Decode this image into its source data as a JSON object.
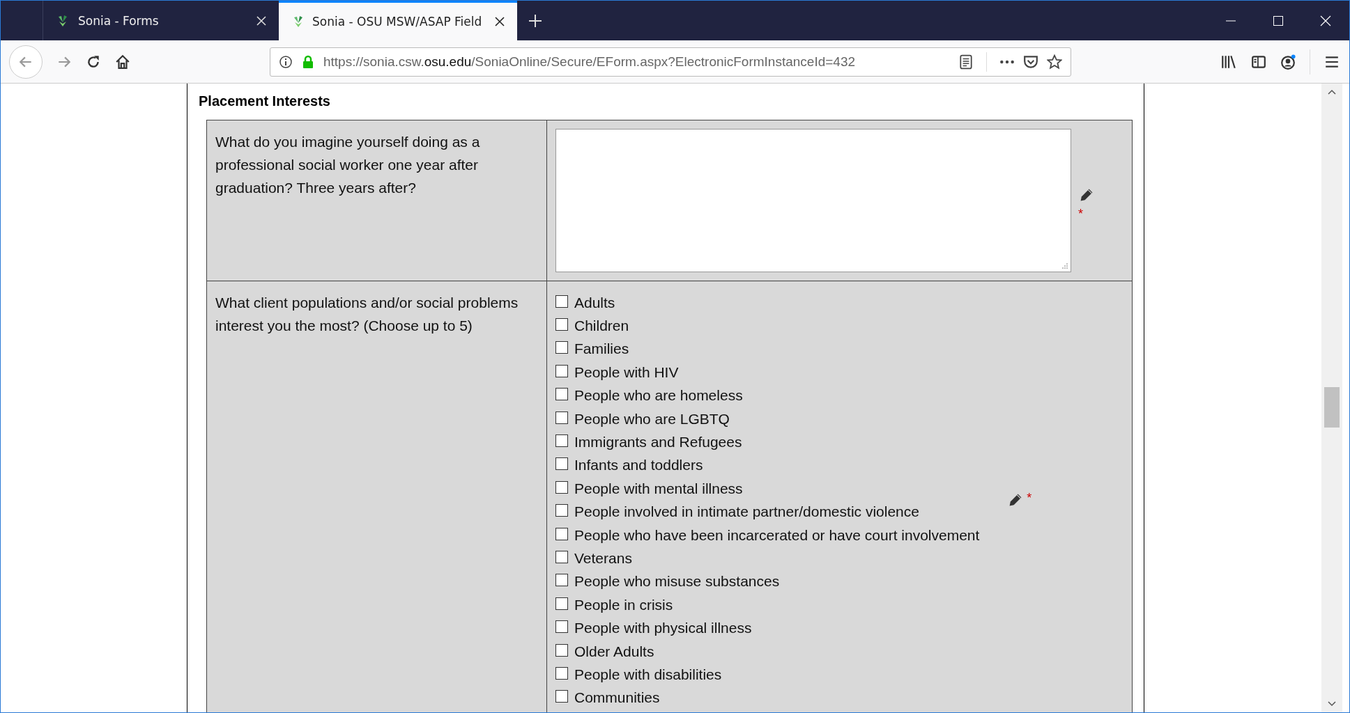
{
  "tabs": [
    {
      "title": "Sonia - Forms",
      "selected": false
    },
    {
      "title": "Sonia - OSU MSW/ASAP Field",
      "selected": true
    }
  ],
  "required_mark": "*",
  "address_bar": {
    "url_start": "https://sonia.csw.",
    "url_domain": "osu.edu",
    "url_end": "/SoniaOnline/Secure/EForm.aspx?ElectronicFormInstanceId=432"
  },
  "section": {
    "title": "Placement Interests"
  },
  "questions": [
    {
      "kind": "textarea",
      "label": "What do you imagine yourself doing as a professional social worker one year after graduation? Three years after?",
      "required": true
    },
    {
      "kind": "checklist",
      "label": "What client populations and/or social problems interest you the most? (Choose up to 5)",
      "required": true,
      "options": [
        {
          "label": "Adults",
          "checked": false
        },
        {
          "label": "Children",
          "checked": false
        },
        {
          "label": "Families",
          "checked": false
        },
        {
          "label": "People with HIV",
          "checked": false
        },
        {
          "label": "People who are homeless",
          "checked": false
        },
        {
          "label": "People who are LGBTQ",
          "checked": false
        },
        {
          "label": "Immigrants and Refugees",
          "checked": false
        },
        {
          "label": "Infants and toddlers",
          "checked": false
        },
        {
          "label": "People with mental illness",
          "checked": false
        },
        {
          "label": "People involved in intimate partner/domestic violence",
          "checked": false
        },
        {
          "label": "People who have been incarcerated or have court involvement",
          "checked": false
        },
        {
          "label": "Veterans",
          "checked": false
        },
        {
          "label": "People who misuse substances",
          "checked": false
        },
        {
          "label": "People in crisis",
          "checked": false
        },
        {
          "label": "People with physical illness",
          "checked": false
        },
        {
          "label": "Older Adults",
          "checked": false
        },
        {
          "label": "People with disabilities",
          "checked": false
        },
        {
          "label": "Communities",
          "checked": false
        }
      ]
    }
  ]
}
